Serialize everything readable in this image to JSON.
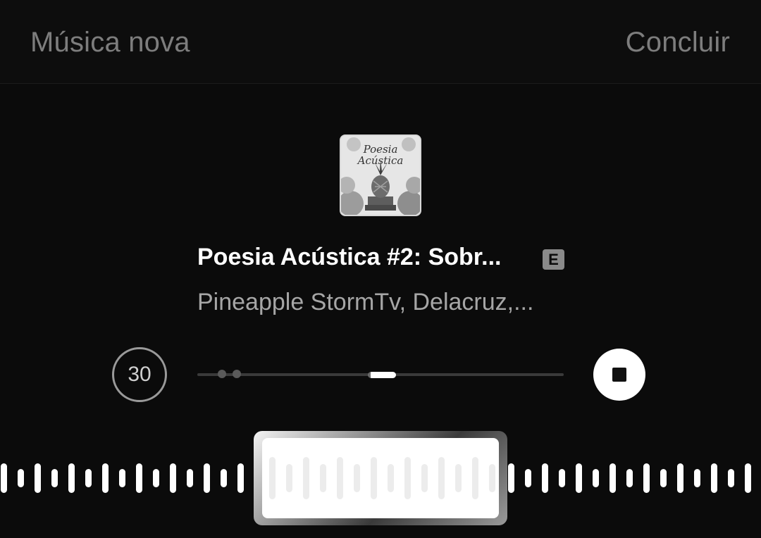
{
  "header": {
    "left_label": "Música nova",
    "right_label": "Concluir"
  },
  "album": {
    "art_text_line1": "Poesia",
    "art_text_line2": "Acústica"
  },
  "track": {
    "title": "Poesia Acústica #2: Sobr...",
    "explicit_badge": "E",
    "artists": "Pineapple StormTv, Delacruz,..."
  },
  "controls": {
    "duration_label": "30",
    "stop_icon": "stop-icon"
  },
  "colors": {
    "background": "#0b0b0b",
    "header_text": "#7d7d7d",
    "title_text": "#ffffff",
    "artist_text": "#a6a6a6",
    "waveform": "#ffffff"
  }
}
